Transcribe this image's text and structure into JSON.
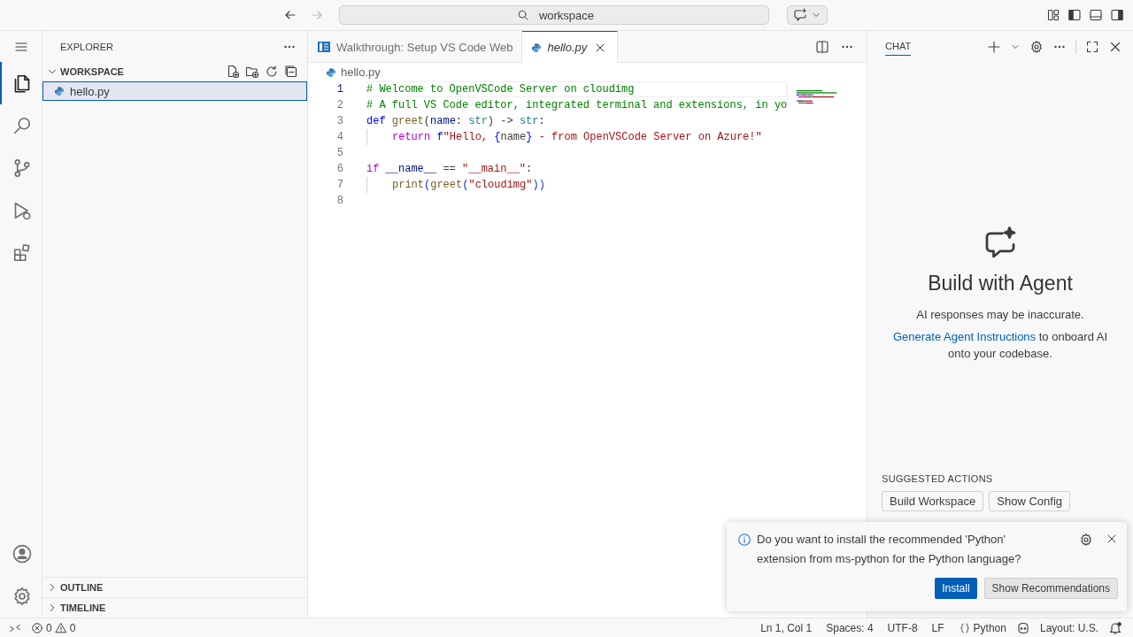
{
  "title_bar": {
    "back": {
      "disabled": false
    },
    "forward": {
      "disabled": true
    },
    "search": {
      "value": "workspace"
    },
    "layout_toggles": [
      {
        "kind": "customize"
      },
      {
        "kind": "sidebar",
        "on": true
      },
      {
        "kind": "panel",
        "on": false
      },
      {
        "kind": "secondary",
        "on": true
      }
    ]
  },
  "activity_bar": {
    "items": [
      {
        "kind": "explorer",
        "selected": true
      },
      {
        "kind": "search",
        "selected": false
      },
      {
        "kind": "scm",
        "selected": false
      },
      {
        "kind": "debug",
        "selected": false
      },
      {
        "kind": "extensions",
        "selected": false
      }
    ],
    "bottom": [
      {
        "kind": "account"
      },
      {
        "kind": "settings"
      }
    ]
  },
  "sidebar": {
    "title": "EXPLORER",
    "sections": [
      {
        "title": "WORKSPACE",
        "expanded": true,
        "files": [
          {
            "name": "hello.py",
            "selected": true
          }
        ]
      },
      {
        "title": "OUTLINE",
        "expanded": false
      },
      {
        "title": "TIMELINE",
        "expanded": false
      }
    ]
  },
  "editor": {
    "tabs": [
      {
        "label": "Walkthrough: Setup VS Code Web",
        "kind": "walkthrough",
        "selected": false,
        "preview": false
      },
      {
        "label": "hello.py",
        "kind": "python",
        "selected": true,
        "preview": true
      }
    ],
    "breadcrumb": "hello.py",
    "lines": [
      {
        "number": "1",
        "current": true,
        "tokens": [
          {
            "kind": "comment",
            "text": "# Welcome to OpenVSCode Server on cloudimg"
          }
        ]
      },
      {
        "number": "2",
        "current": false,
        "tokens": [
          {
            "kind": "comment",
            "text": "# A full VS Code editor, integrated terminal and extensions, in yo"
          }
        ]
      },
      {
        "number": "3",
        "current": false,
        "tokens": [
          {
            "kind": "keyword",
            "text": "def "
          },
          {
            "kind": "function",
            "text": "greet"
          },
          {
            "kind": "plain",
            "text": "("
          },
          {
            "kind": "variable",
            "text": "name"
          },
          {
            "kind": "plain",
            "text": ": "
          },
          {
            "kind": "type",
            "text": "str"
          },
          {
            "kind": "plain",
            "text": ") -> "
          },
          {
            "kind": "type",
            "text": "str"
          },
          {
            "kind": "plain",
            "text": ":"
          }
        ]
      },
      {
        "number": "4",
        "current": false,
        "indented": true,
        "tokens": [
          {
            "kind": "control",
            "text": "return "
          },
          {
            "kind": "keyword",
            "text": "f"
          },
          {
            "kind": "string",
            "text": "\"Hello, "
          },
          {
            "kind": "keyword",
            "text": "{"
          },
          {
            "kind": "plain",
            "text": "name"
          },
          {
            "kind": "keyword",
            "text": "}"
          },
          {
            "kind": "string",
            "text": " - from OpenVSCode Server on Azure!\""
          }
        ]
      },
      {
        "number": "5",
        "current": false
      },
      {
        "number": "6",
        "current": false,
        "tokens": [
          {
            "kind": "control",
            "text": "if "
          },
          {
            "kind": "variable",
            "text": "__name__"
          },
          {
            "kind": "plain",
            "text": " == "
          },
          {
            "kind": "string",
            "text": "\"__main__\""
          },
          {
            "kind": "plain",
            "text": ":"
          }
        ]
      },
      {
        "number": "7",
        "current": false,
        "indented": true,
        "tokens": [
          {
            "kind": "function",
            "text": "print"
          },
          {
            "kind": "bracket",
            "text": "("
          },
          {
            "kind": "function",
            "text": "greet"
          },
          {
            "kind": "bracket",
            "text": "("
          },
          {
            "kind": "string",
            "text": "\"cloudimg\""
          },
          {
            "kind": "bracket",
            "text": "))"
          }
        ]
      },
      {
        "number": "8",
        "current": false
      }
    ]
  },
  "chat": {
    "title": "CHAT",
    "heading": "Build with Agent",
    "disclaimer": "AI responses may be inaccurate.",
    "link": "Generate Agent Instructions",
    "link_suffix": "to onboard AI onto your codebase.",
    "suggested_title": "SUGGESTED ACTIONS",
    "suggested_actions": [
      "Build Workspace",
      "Show Config"
    ]
  },
  "notification": {
    "message": "Do you want to install the recommended 'Python' extension from ms-python for the Python language?",
    "buttons": [
      {
        "label": "Install",
        "kind": "primary"
      },
      {
        "label": "Show Recommendations",
        "kind": "secondary"
      }
    ]
  },
  "status_bar": {
    "errors": "0",
    "warnings": "0",
    "items": [
      "Ln 1, Col 1",
      "Spaces: 4",
      "UTF-8",
      "LF",
      "Python",
      "Layout: U.S."
    ]
  }
}
